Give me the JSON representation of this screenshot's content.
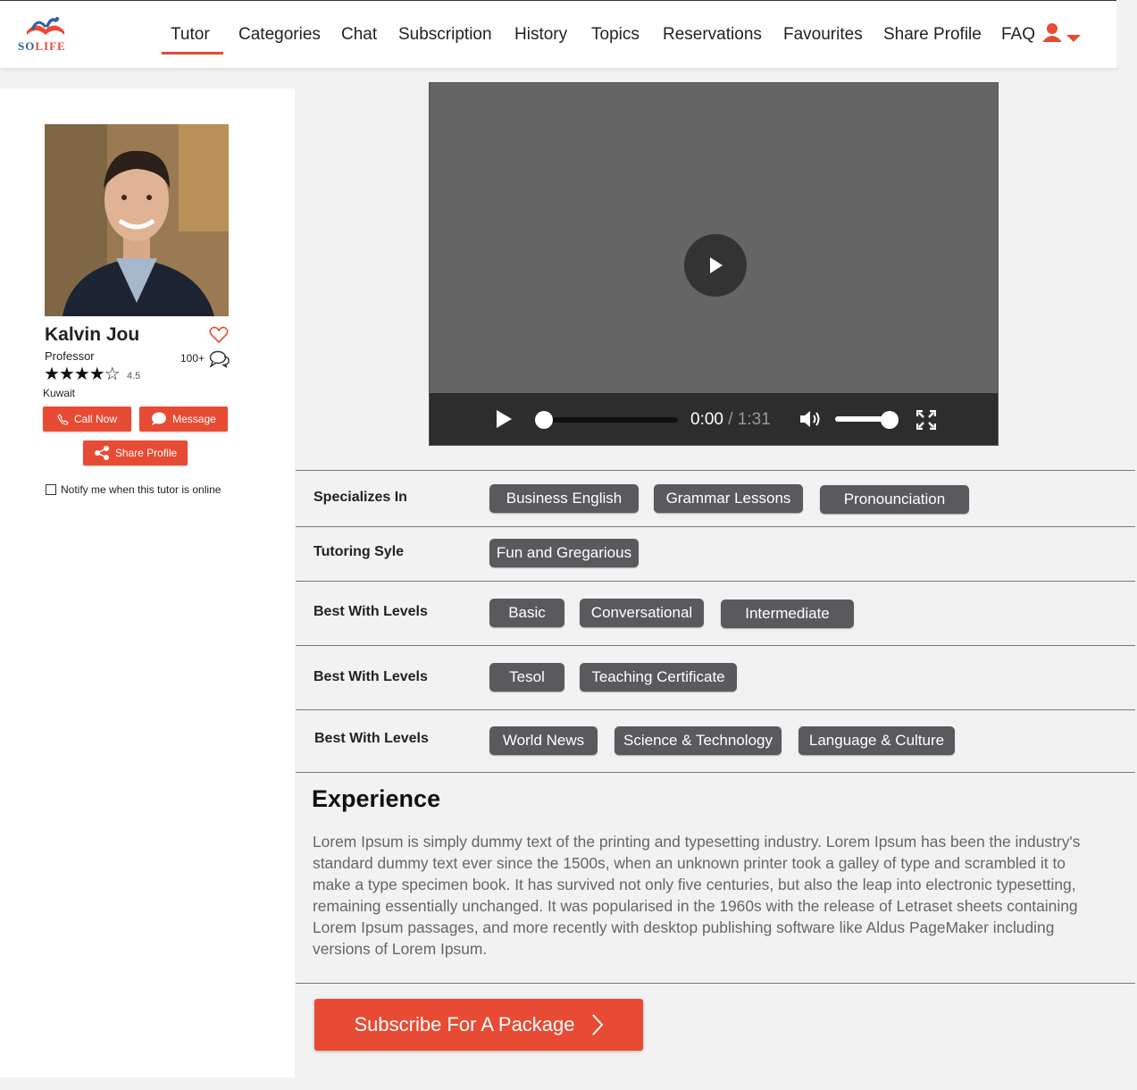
{
  "brand": {
    "logo_text_so": "SO",
    "logo_text_life": "LIFE"
  },
  "nav": {
    "items": [
      {
        "label": "Tutor",
        "active": true
      },
      {
        "label": "Categories"
      },
      {
        "label": "Chat"
      },
      {
        "label": "Subscription"
      },
      {
        "label": "History"
      },
      {
        "label": "Topics"
      },
      {
        "label": "Reservations"
      },
      {
        "label": "Favourites"
      },
      {
        "label": "Share Profile"
      },
      {
        "label": "FAQ"
      }
    ],
    "user_icon": "user-icon",
    "accent_color": "#e84b33"
  },
  "tutor": {
    "name": "Kalvin Jou",
    "title": "Professor",
    "reviews": "100+",
    "stars": "★★★★☆",
    "rating": "4.5",
    "location": "Kuwait",
    "call_label": "Call Now",
    "message_label": "Message",
    "share_label": "Share Profile",
    "notify_label": "Notify me when this tutor is online"
  },
  "video": {
    "current_time": "0:00",
    "separator": " / ",
    "duration": "1:31"
  },
  "rows": [
    {
      "label": "Specializes In",
      "tags": [
        "Business English",
        "Grammar Lessons",
        "Pronounciation"
      ]
    },
    {
      "label": "Tutoring Syle",
      "tags": [
        "Fun and Gregarious"
      ]
    },
    {
      "label": "Best With Levels",
      "tags": [
        "Basic",
        "Conversational",
        "Intermediate"
      ]
    },
    {
      "label": "Best With Levels",
      "tags": [
        "Tesol",
        "Teaching Certificate"
      ]
    },
    {
      "label": "Best With Levels",
      "tags": [
        "World News",
        "Science & Technology",
        "Language & Culture"
      ]
    }
  ],
  "experience": {
    "title": "Experience",
    "body": "Lorem Ipsum is simply dummy text of the printing and typesetting industry. Lorem Ipsum has been the industry's standard dummy text ever since the 1500s, when an unknown printer took a galley of type and scrambled it to make a type specimen book. It has survived not only five centuries, but also the leap into electronic typesetting, remaining essentially unchanged. It was popularised in the 1960s with the release of Letraset sheets containing Lorem Ipsum passages, and more recently with desktop publishing software like Aldus PageMaker including versions of Lorem Ipsum."
  },
  "subscribe": {
    "label": "Subscribe For A Package"
  }
}
